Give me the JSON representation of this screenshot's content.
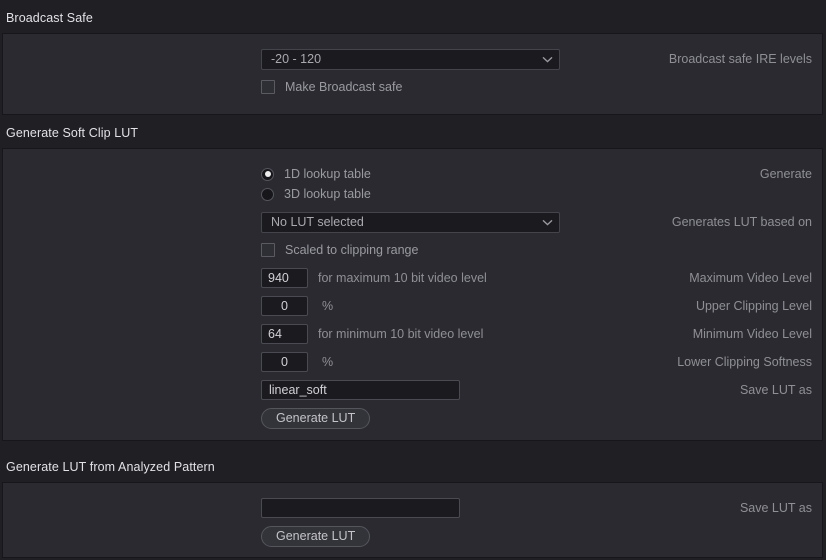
{
  "colors": {
    "background": "#1f1f24",
    "panel": "#2a2a30",
    "panel_border": "#17171b",
    "input_background": "#1b1b1f",
    "input_border": "#4a4a53",
    "label_text": "#8f8f96",
    "value_text": "#d2d2d6",
    "heading_text": "#e2e2e6",
    "radio_dot": "#ececed"
  },
  "broadcast_safe": {
    "section_title": "Broadcast Safe",
    "ire_levels": {
      "label": "Broadcast safe IRE levels",
      "value": "-20 - 120",
      "icon": "chevron-down-icon",
      "options": [
        "-20 - 120"
      ]
    },
    "make_broadcast_safe": {
      "label": "Make Broadcast safe",
      "checked": false
    }
  },
  "soft_clip_lut": {
    "section_title": "Generate Soft Clip LUT",
    "generate": {
      "label": "Generate",
      "options": [
        {
          "label": "1D lookup table",
          "selected": true
        },
        {
          "label": "3D lookup table",
          "selected": false
        }
      ]
    },
    "based_on": {
      "label": "Generates LUT based on",
      "value": "No LUT selected",
      "icon": "chevron-down-icon",
      "options": [
        "No LUT selected"
      ]
    },
    "scaled_to_clipping_range": {
      "label": "Scaled to clipping range",
      "checked": false
    },
    "fields": [
      {
        "label": "Maximum Video Level",
        "value": "940",
        "align": "left",
        "suffix": "for maximum 10 bit video level"
      },
      {
        "label": "Upper Clipping Level",
        "value": "0",
        "align": "center",
        "suffix": "%"
      },
      {
        "label": "Minimum Video Level",
        "value": "64",
        "align": "left",
        "suffix": "for minimum 10 bit video level"
      },
      {
        "label": "Lower Clipping Softness",
        "value": "0",
        "align": "center",
        "suffix": "%"
      }
    ],
    "save_lut_as": {
      "label": "Save LUT as",
      "value": "linear_soft",
      "placeholder": ""
    },
    "generate_button": "Generate LUT"
  },
  "analyzed_pattern": {
    "section_title": "Generate LUT from Analyzed Pattern",
    "save_lut_as": {
      "label": "Save LUT as",
      "value": "",
      "placeholder": ""
    },
    "generate_button": "Generate LUT"
  }
}
